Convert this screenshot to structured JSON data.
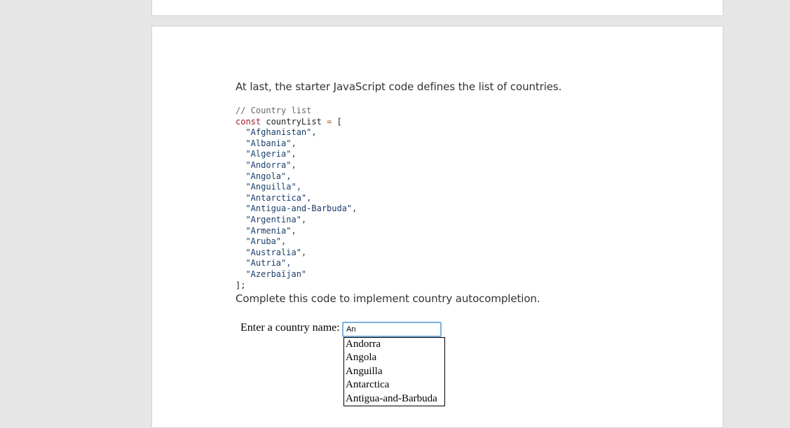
{
  "intro_text": "At last, the starter JavaScript code defines the list of countries.",
  "code": {
    "comment": "// Country list",
    "decl_keyword": "const",
    "decl_name": "countryList",
    "decl_op": "=",
    "decl_open": "[",
    "items": [
      "\"Afghanistan\",",
      "\"Albania\",",
      "\"Algeria\",",
      "\"Andorra\",",
      "\"Angola\",",
      "\"Anguilla\",",
      "\"Antarctica\",",
      "\"Antigua-and-Barbuda\",",
      "\"Argentina\",",
      "\"Armenia\",",
      "\"Aruba\",",
      "\"Australia\",",
      "\"Autria\",",
      "\"Azerbaïjan\""
    ],
    "close": "];"
  },
  "outro_text": "Complete this code to implement country autocompletion.",
  "form": {
    "label": "Enter a country name:",
    "input_value": "An"
  },
  "suggestions": [
    "Andorra",
    "Angola",
    "Anguilla",
    "Antarctica",
    "Antigua-and-Barbuda"
  ],
  "colors": {
    "page_background": "#e6e6e6",
    "card_background": "#ffffff",
    "keyword": "#a0202a",
    "string": "#1a3f6a",
    "comment": "#6a6a6a",
    "input_focus_border": "#7fb0e0"
  }
}
